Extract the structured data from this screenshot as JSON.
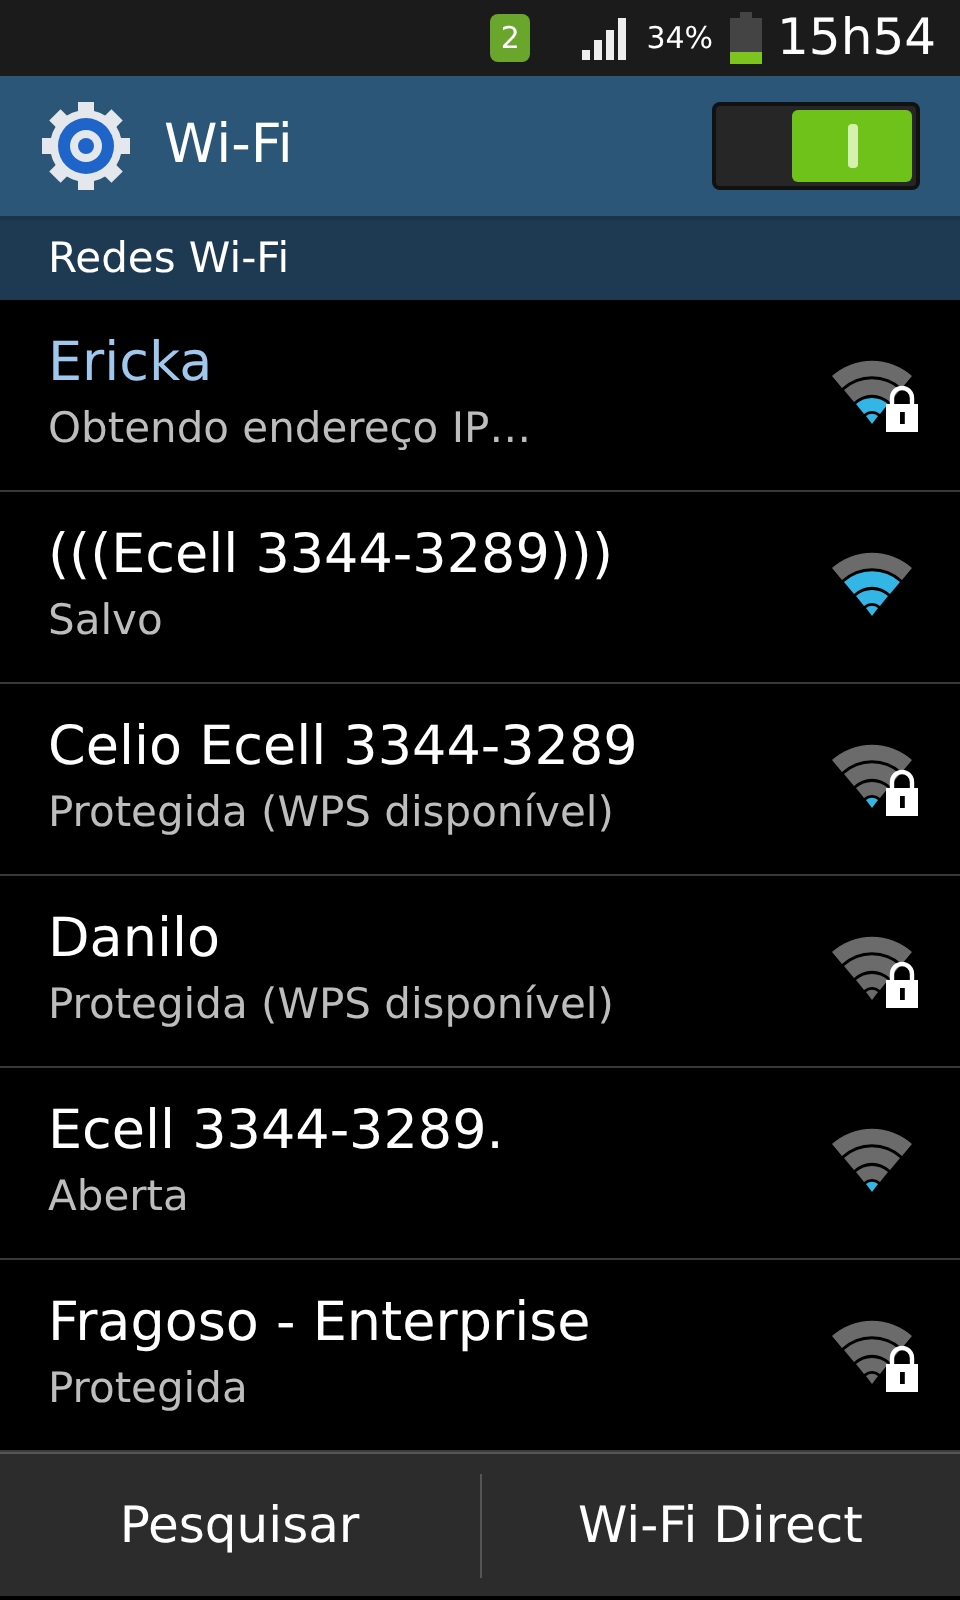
{
  "status_bar": {
    "sim": "2",
    "battery": "34%",
    "time": "15h54"
  },
  "action_bar": {
    "title": "Wi-Fi",
    "switch_on": true
  },
  "section": "Redes Wi-Fi",
  "networks": [
    {
      "name": "Ericka",
      "status": "Obtendo endereço IP…",
      "active": true,
      "secured": true,
      "kind": "fair"
    },
    {
      "name": "(((Ecell 3344-3289)))",
      "status": "Salvo",
      "active": false,
      "secured": false,
      "kind": "good"
    },
    {
      "name": "Celio Ecell 3344-3289",
      "status": "Protegida (WPS disponível)",
      "active": false,
      "secured": true,
      "kind": "weak"
    },
    {
      "name": "Danilo",
      "status": "Protegida (WPS disponível)",
      "active": false,
      "secured": true,
      "kind": "none"
    },
    {
      "name": "Ecell 3344-3289.",
      "status": "Aberta",
      "active": false,
      "secured": false,
      "kind": "weak"
    },
    {
      "name": "Fragoso - Enterprise",
      "status": "Protegida",
      "active": false,
      "secured": true,
      "kind": "none"
    }
  ],
  "buttons": [
    "Pesquisar",
    "Wi-Fi Direct"
  ]
}
